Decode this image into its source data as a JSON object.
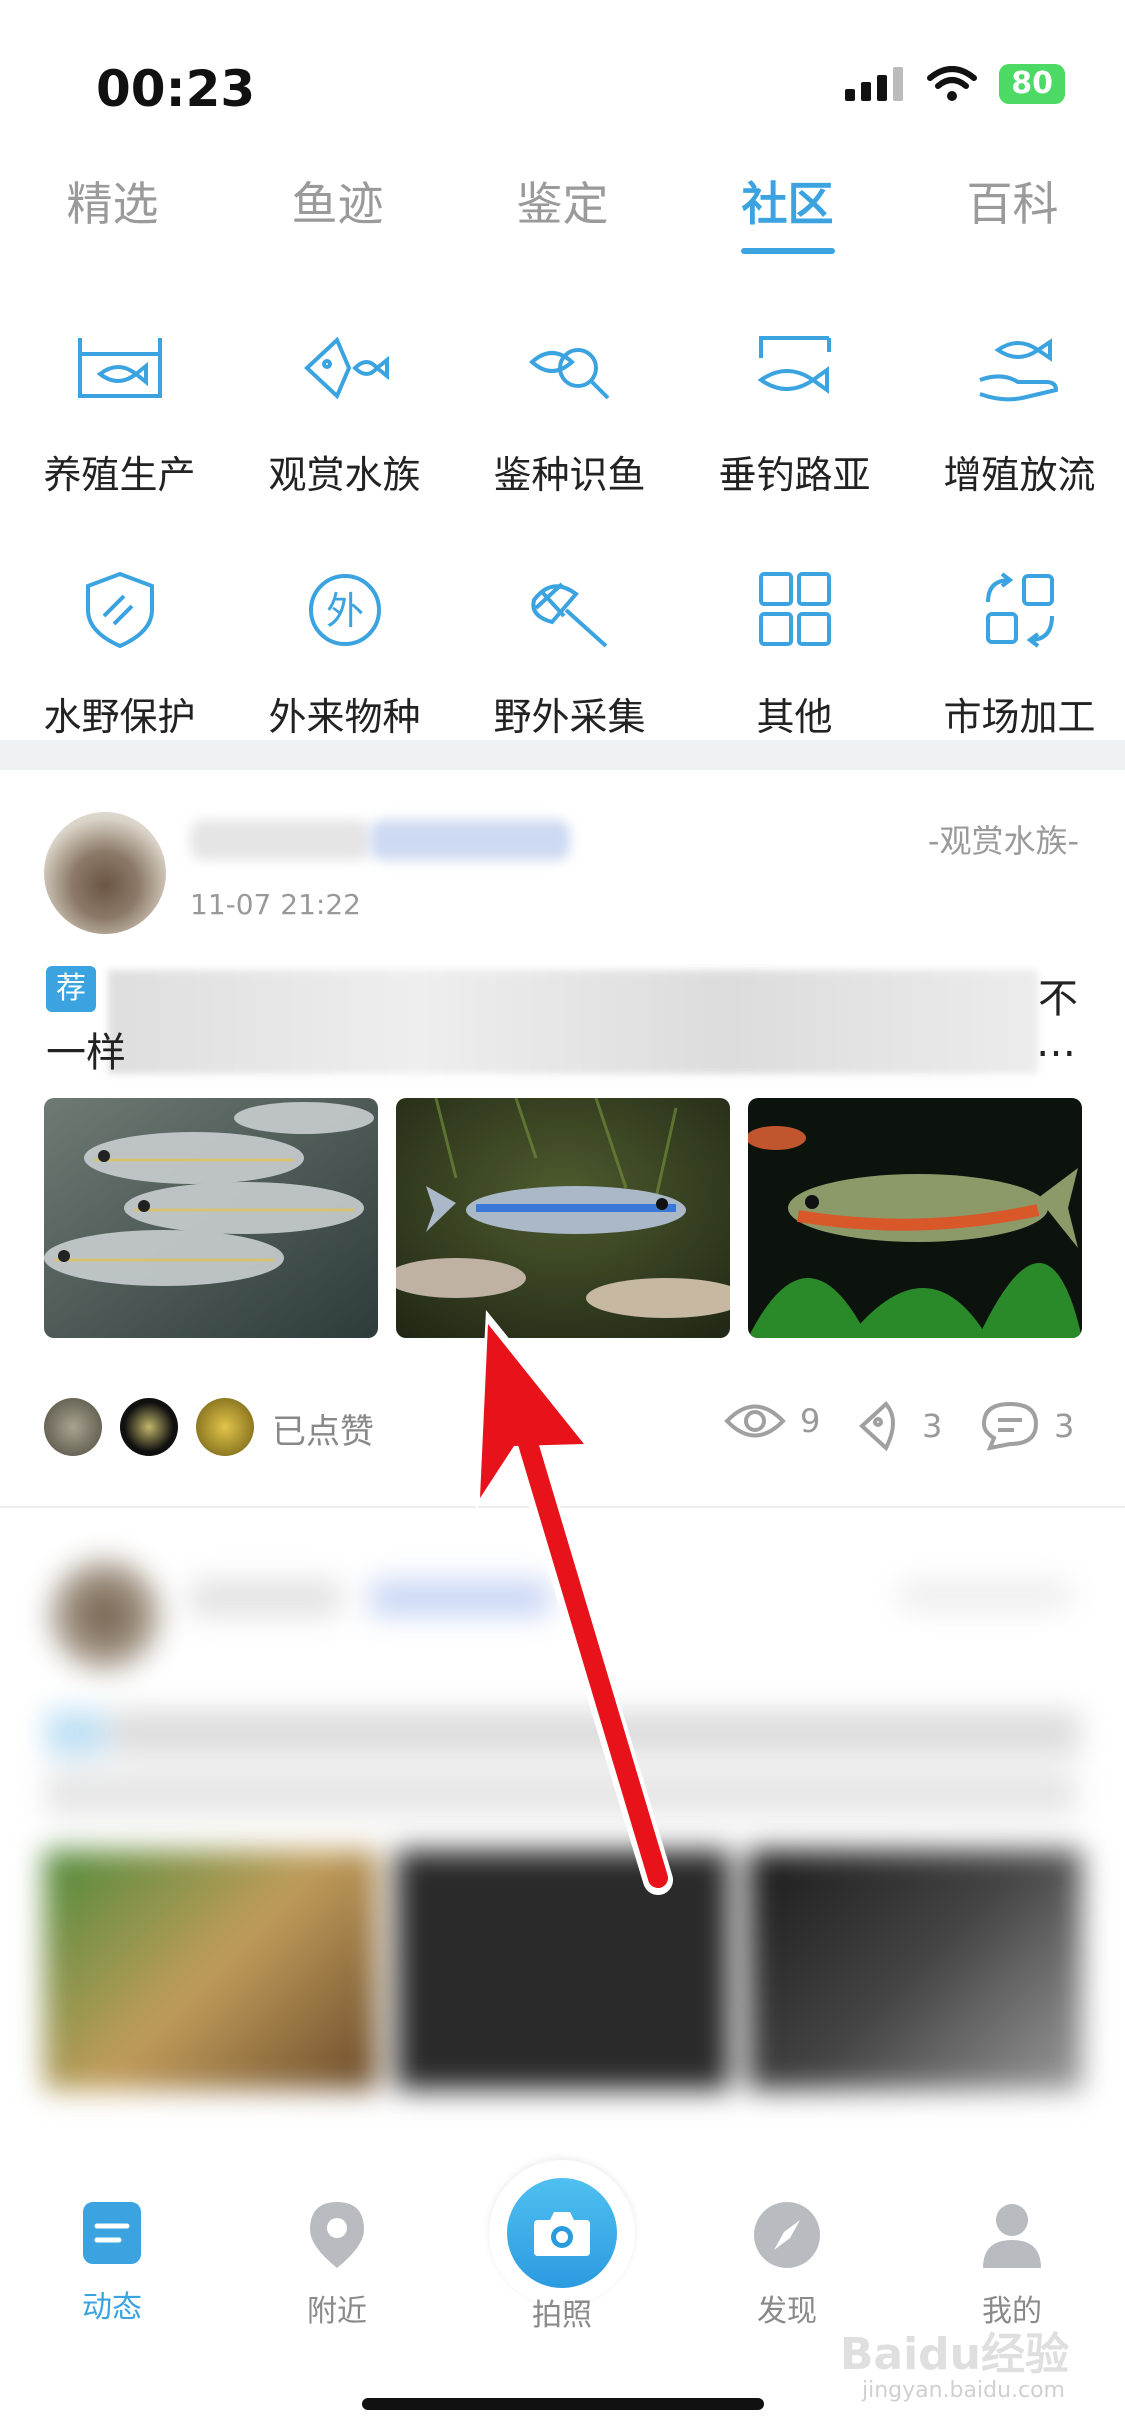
{
  "status_bar": {
    "time": "00:23",
    "battery": "80"
  },
  "top_tabs": [
    "精选",
    "鱼迹",
    "鉴定",
    "社区",
    "百科"
  ],
  "categories": [
    "养殖生产",
    "观赏水族",
    "鉴种识鱼",
    "垂钓路亚",
    "增殖放流",
    "水野保护",
    "外来物种",
    "野外采集",
    "其他",
    "市场加工"
  ],
  "category_icon_glyph": "外",
  "post": {
    "time": "11-07 21:22",
    "category": "-观赏水族-",
    "rec_tag": "荐",
    "line1_end": "不",
    "line2_start": "一样",
    "line2_end": "…",
    "liked_label": "已点赞",
    "views": "9",
    "likes": "3",
    "comments": "3"
  },
  "bottom_nav": {
    "items": [
      "动态",
      "附近",
      "拍照",
      "发现",
      "我的"
    ]
  },
  "watermark": {
    "main": "Baidu经验",
    "sub": "jingyan.baidu.com"
  },
  "colors": {
    "accent": "#3aa3e0",
    "annotation_arrow": "#e8121b"
  }
}
